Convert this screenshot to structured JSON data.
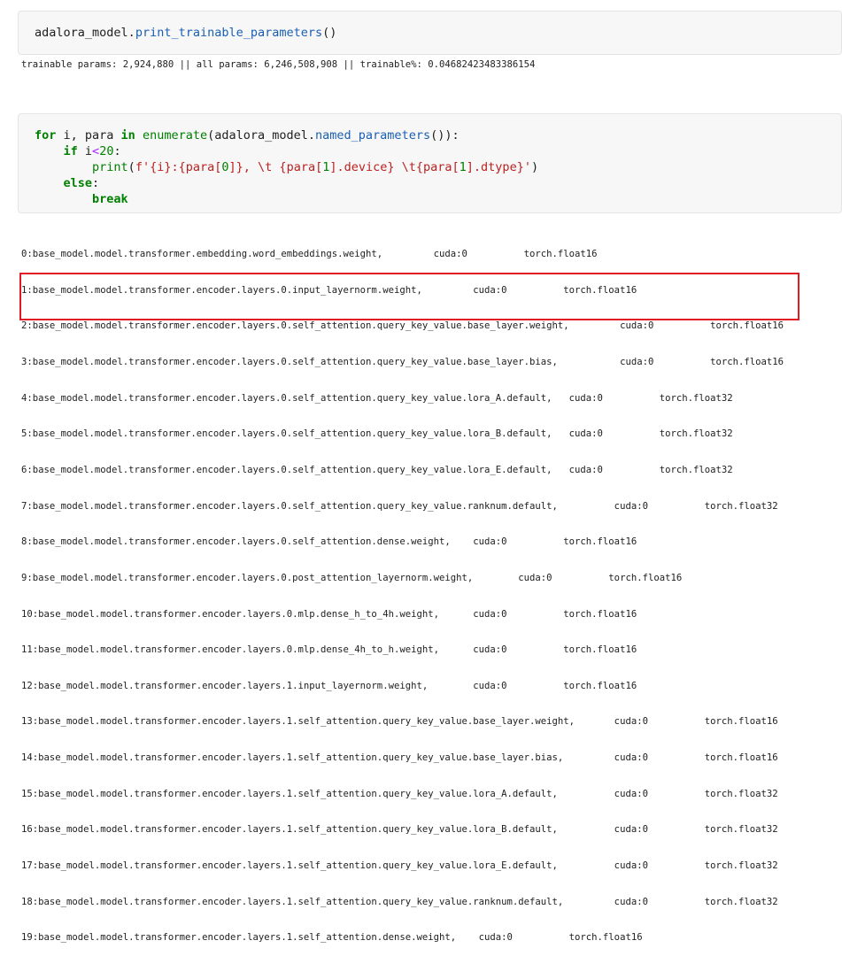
{
  "cell1": {
    "code": {
      "obj": "adalora_model",
      "dot": ".",
      "method": "print_trainable_parameters",
      "parens": "()"
    },
    "output": "trainable params: 2,924,880 || all params: 6,246,508,908 || trainable%: 0.04682423483386154"
  },
  "cell2": {
    "code": {
      "l1_for": "for",
      "l1_a": " i, para ",
      "l1_in": "in",
      "l1_sp": " ",
      "l1_enum": "enumerate",
      "l1_b": "(adalora_model.",
      "l1_np": "named_parameters",
      "l1_c": "()):",
      "l2_indent": "    ",
      "l2_if": "if",
      "l2_i": " i",
      "l2_lt": "<",
      "l2_num": "20",
      "l2_colon": ":",
      "l3_indent": "        ",
      "l3_print": "print",
      "l3_a": "(",
      "l3_f": "f'",
      "l3_s1": "{i}",
      "l3_s2": ":",
      "l3_s3": "{para[",
      "l3_n0": "0",
      "l3_s4": "]}",
      "l3_s5": ", \\t {para[",
      "l3_n1": "1",
      "l3_s6": "].device} \\t{para[",
      "l3_n2": "1",
      "l3_s7": "].dtype}",
      "l3_q": "'",
      "l3_end": ")",
      "l4_indent": "    ",
      "l4_else": "else",
      "l4_colon": ":",
      "l5_indent": "        ",
      "l5_break": "break"
    },
    "output_lines": [
      "0:base_model.model.transformer.embedding.word_embeddings.weight,         cuda:0          torch.float16",
      "1:base_model.model.transformer.encoder.layers.0.input_layernorm.weight,         cuda:0          torch.float16",
      "2:base_model.model.transformer.encoder.layers.0.self_attention.query_key_value.base_layer.weight,         cuda:0          torch.float16",
      "3:base_model.model.transformer.encoder.layers.0.self_attention.query_key_value.base_layer.bias,           cuda:0          torch.float16",
      "4:base_model.model.transformer.encoder.layers.0.self_attention.query_key_value.lora_A.default,   cuda:0          torch.float32",
      "5:base_model.model.transformer.encoder.layers.0.self_attention.query_key_value.lora_B.default,   cuda:0          torch.float32",
      "6:base_model.model.transformer.encoder.layers.0.self_attention.query_key_value.lora_E.default,   cuda:0          torch.float32",
      "7:base_model.model.transformer.encoder.layers.0.self_attention.query_key_value.ranknum.default,          cuda:0          torch.float32",
      "8:base_model.model.transformer.encoder.layers.0.self_attention.dense.weight,    cuda:0          torch.float16",
      "9:base_model.model.transformer.encoder.layers.0.post_attention_layernorm.weight,        cuda:0          torch.float16",
      "10:base_model.model.transformer.encoder.layers.0.mlp.dense_h_to_4h.weight,      cuda:0          torch.float16",
      "11:base_model.model.transformer.encoder.layers.0.mlp.dense_4h_to_h.weight,      cuda:0          torch.float16",
      "12:base_model.model.transformer.encoder.layers.1.input_layernorm.weight,        cuda:0          torch.float16",
      "13:base_model.model.transformer.encoder.layers.1.self_attention.query_key_value.base_layer.weight,       cuda:0          torch.float16",
      "14:base_model.model.transformer.encoder.layers.1.self_attention.query_key_value.base_layer.bias,         cuda:0          torch.float16",
      "15:base_model.model.transformer.encoder.layers.1.self_attention.query_key_value.lora_A.default,          cuda:0          torch.float32",
      "16:base_model.model.transformer.encoder.layers.1.self_attention.query_key_value.lora_B.default,          cuda:0          torch.float32",
      "17:base_model.model.transformer.encoder.layers.1.self_attention.query_key_value.lora_E.default,          cuda:0          torch.float32",
      "18:base_model.model.transformer.encoder.layers.1.self_attention.query_key_value.ranknum.default,         cuda:0          torch.float32",
      "19:base_model.model.transformer.encoder.layers.1.self_attention.dense.weight,    cuda:0          torch.float16"
    ]
  },
  "colors": {
    "keyword": "#008000",
    "method": "#1a5fb4",
    "string": "#ba2121",
    "highlight_box": "#e01b24",
    "cell_bg": "#f7f7f7"
  }
}
